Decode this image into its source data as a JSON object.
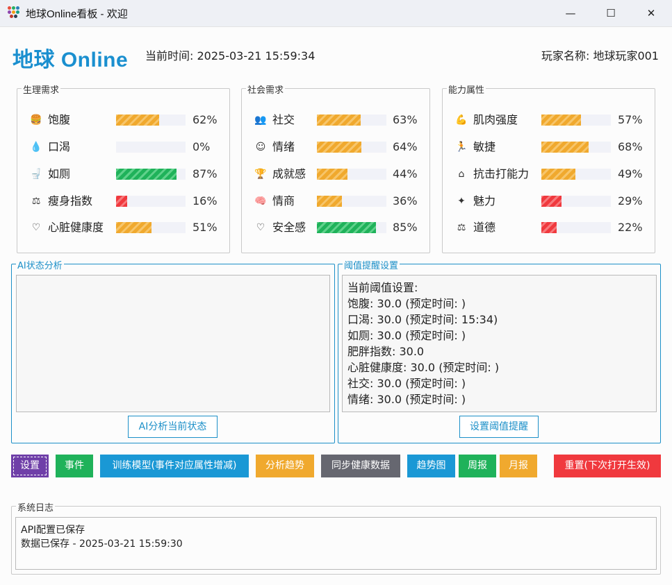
{
  "window": {
    "title": "地球Online看板 - 欢迎",
    "minimize_glyph": "—",
    "maximize_glyph": "☐",
    "close_glyph": "✕"
  },
  "header": {
    "app_title": "地球 Online",
    "current_time": "当前时间: 2025-03-21 15:59:34",
    "player_name": "玩家名称: 地球玩家001"
  },
  "groups": [
    {
      "title": "生理需求",
      "items": [
        {
          "icon": "burger-icon",
          "glyph": "🍔",
          "label": "饱腹",
          "value": 62,
          "value_text": "62%",
          "color": "orange"
        },
        {
          "icon": "water-drop-icon",
          "glyph": "💧",
          "label": "口渴",
          "value": 0,
          "value_text": "0%",
          "color": "orange"
        },
        {
          "icon": "toilet-icon",
          "glyph": "🚽",
          "label": "如厕",
          "value": 87,
          "value_text": "87%",
          "color": "green"
        },
        {
          "icon": "scale-icon",
          "glyph": "⚖",
          "label": "瘦身指数",
          "value": 16,
          "value_text": "16%",
          "color": "red"
        },
        {
          "icon": "heart-icon",
          "glyph": "♡",
          "label": "心脏健康度",
          "value": 51,
          "value_text": "51%",
          "color": "orange"
        }
      ]
    },
    {
      "title": "社会需求",
      "items": [
        {
          "icon": "people-icon",
          "glyph": "👥",
          "label": "社交",
          "value": 63,
          "value_text": "63%",
          "color": "orange"
        },
        {
          "icon": "smile-icon",
          "glyph": "☺",
          "label": "情绪",
          "value": 64,
          "value_text": "64%",
          "color": "orange"
        },
        {
          "icon": "trophy-icon",
          "glyph": "🏆",
          "label": "成就感",
          "value": 44,
          "value_text": "44%",
          "color": "orange"
        },
        {
          "icon": "brain-icon",
          "glyph": "🧠",
          "label": "情商",
          "value": 36,
          "value_text": "36%",
          "color": "orange"
        },
        {
          "icon": "shield-heart-icon",
          "glyph": "♡",
          "label": "安全感",
          "value": 85,
          "value_text": "85%",
          "color": "green"
        }
      ]
    },
    {
      "title": "能力属性",
      "items": [
        {
          "icon": "muscle-icon",
          "glyph": "💪",
          "label": "肌肉强度",
          "value": 57,
          "value_text": "57%",
          "color": "orange"
        },
        {
          "icon": "runner-icon",
          "glyph": "🏃",
          "label": "敏捷",
          "value": 68,
          "value_text": "68%",
          "color": "orange"
        },
        {
          "icon": "house-icon",
          "glyph": "⌂",
          "label": "抗击打能力",
          "value": 49,
          "value_text": "49%",
          "color": "orange"
        },
        {
          "icon": "sparkle-icon",
          "glyph": "✦",
          "label": "魅力",
          "value": 29,
          "value_text": "29%",
          "color": "red"
        },
        {
          "icon": "balance-icon",
          "glyph": "⚖",
          "label": "道德",
          "value": 22,
          "value_text": "22%",
          "color": "red"
        }
      ]
    }
  ],
  "ai_panel": {
    "title": "AI状态分析",
    "content": "",
    "button_label": "AI分析当前状态"
  },
  "threshold_panel": {
    "title": "阈值提醒设置",
    "lines": [
      "当前阈值设置:",
      "饱腹: 30.0 (预定时间: )",
      "口渴: 30.0 (预定时间: 15:34)",
      "如厕: 30.0 (预定时间: )",
      "肥胖指数: 30.0",
      "心脏健康度: 30.0 (预定时间: )",
      "社交: 30.0 (预定时间: )",
      "情绪: 30.0 (预定时间: )"
    ],
    "button_label": "设置阈值提醒"
  },
  "actions": [
    {
      "label": "设置",
      "color": "#6f3fa8",
      "name": "settings-button"
    },
    {
      "label": "事件",
      "color": "#1fb25a",
      "name": "events-button"
    },
    {
      "label": "训练模型(事件对应属性增减)",
      "color": "#1a98d5",
      "name": "train-model-button"
    },
    {
      "label": "分析趋势",
      "color": "#f0a92e",
      "name": "analyze-trend-button"
    },
    {
      "label": "同步健康数据",
      "color": "#666770",
      "name": "sync-health-button"
    },
    {
      "label": "趋势图",
      "color": "#1a98d5",
      "name": "trend-chart-button"
    },
    {
      "label": "周报",
      "color": "#1fb25a",
      "name": "weekly-report-button"
    },
    {
      "label": "月报",
      "color": "#f0a92e",
      "name": "monthly-report-button"
    },
    {
      "label": "重置(下次打开生效)",
      "color": "#f0393e",
      "name": "reset-button"
    }
  ],
  "log": {
    "title": "系统日志",
    "lines": [
      "API配置已保存",
      "数据已保存 - 2025-03-21 15:59:30"
    ]
  }
}
